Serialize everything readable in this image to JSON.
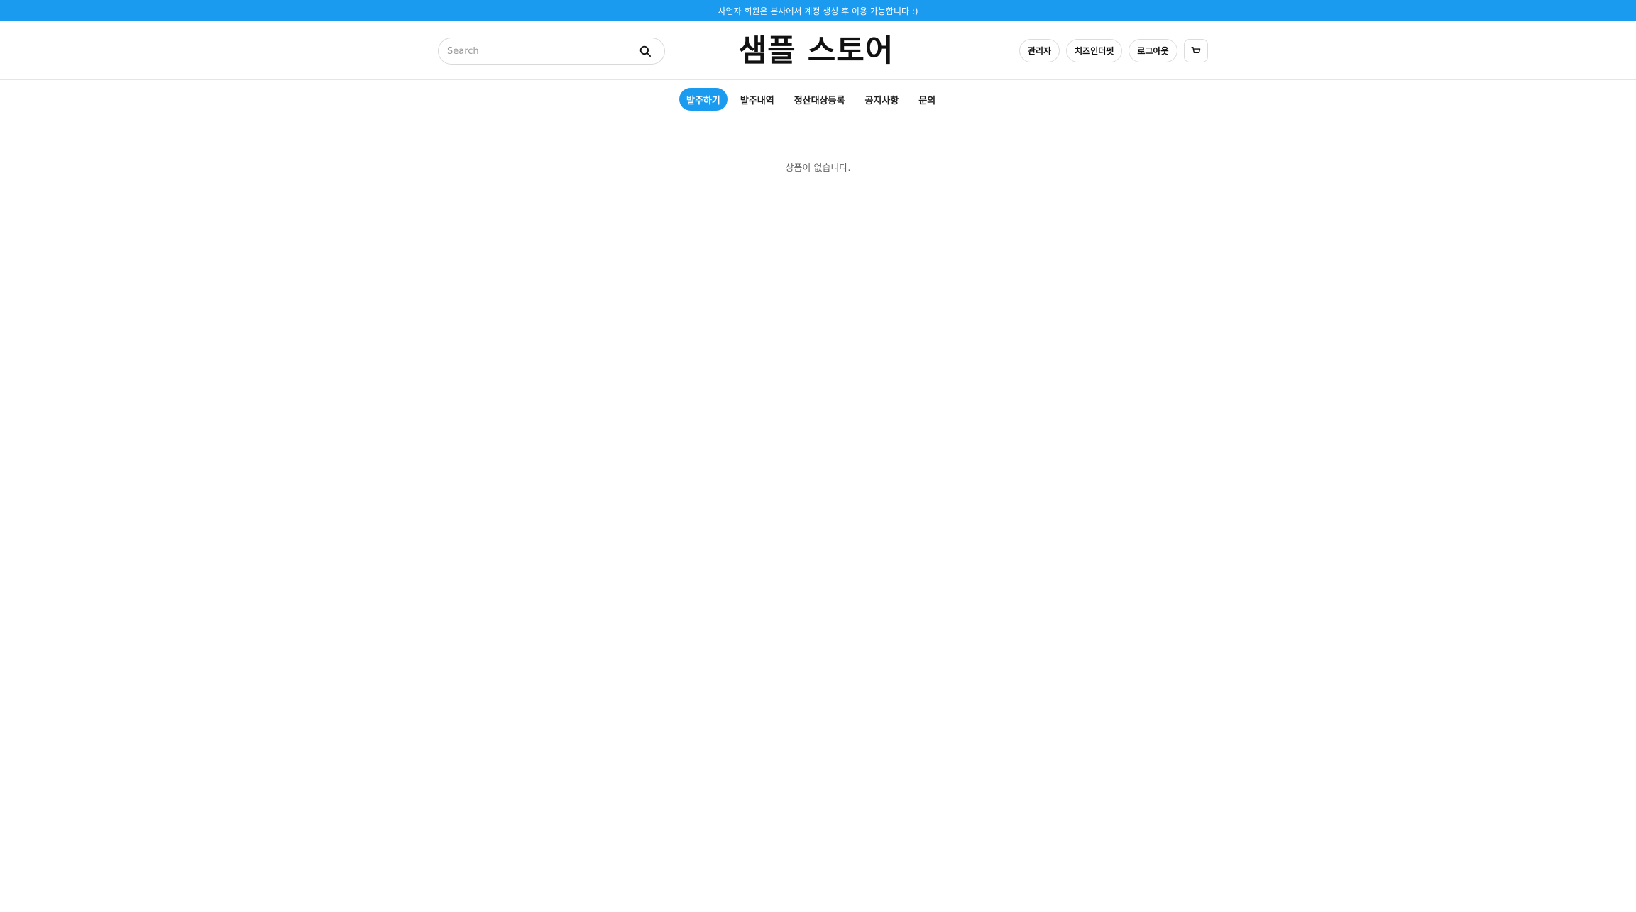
{
  "announcement": "사업자 회원은 본사에서 계정 생성 후 이용 가능합니다 :)",
  "header": {
    "search": {
      "placeholder": "Search",
      "value": ""
    },
    "logo": "샘플 스토어",
    "actions": {
      "admin": "관리자",
      "user": "치즈인더펫",
      "logout": "로그아웃"
    }
  },
  "nav": {
    "items": [
      {
        "label": "발주하기",
        "active": true
      },
      {
        "label": "발주내역",
        "active": false
      },
      {
        "label": "정산대상등록",
        "active": false
      },
      {
        "label": "공지사항",
        "active": false
      },
      {
        "label": "문의",
        "active": false
      }
    ]
  },
  "main": {
    "empty_message": "상품이 없습니다."
  },
  "colors": {
    "accent": "#1b9bef"
  },
  "icons": {
    "search": "search-icon",
    "cart": "cart-icon"
  }
}
